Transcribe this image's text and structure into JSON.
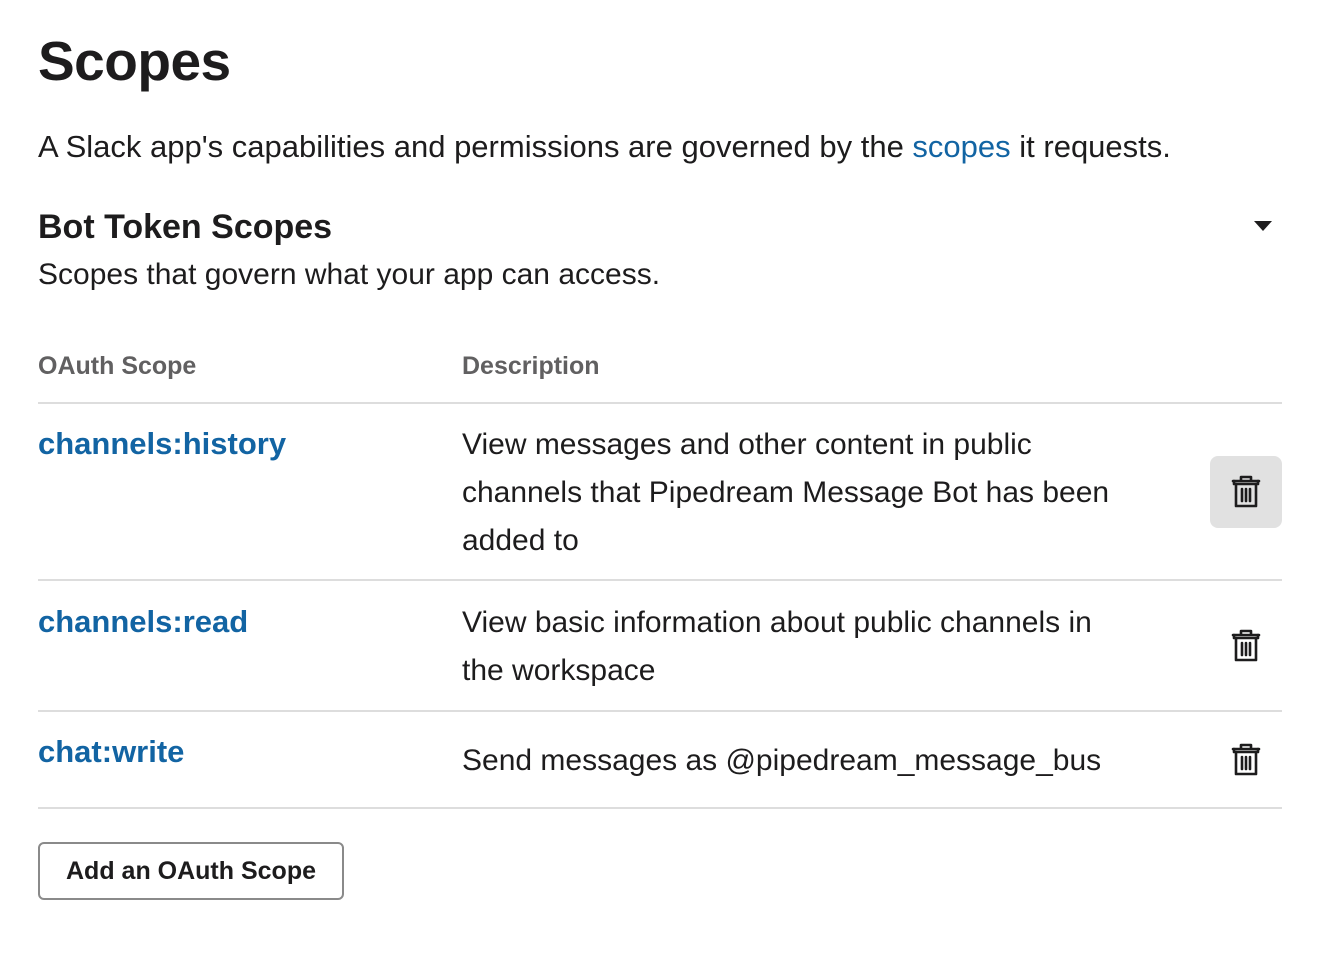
{
  "page": {
    "title": "Scopes",
    "intro_before": "A Slack app's capabilities and permissions are governed by the ",
    "intro_link": "scopes",
    "intro_after": " it requests."
  },
  "section": {
    "title": "Bot Token Scopes",
    "subtitle": "Scopes that govern what your app can access.",
    "toggle_icon": "caret-down-icon"
  },
  "table": {
    "headers": {
      "scope": "OAuth Scope",
      "description": "Description"
    },
    "rows": [
      {
        "scope": "channels:history",
        "description": "View messages and other content in public channels that Pipedream Message Bot has been added to",
        "action_icon": "trash-icon"
      },
      {
        "scope": "channels:read",
        "description": "View basic information about public channels in the workspace",
        "action_icon": "trash-icon"
      },
      {
        "scope": "chat:write",
        "description": "Send messages as @pipedream_message_bus",
        "action_icon": "trash-icon"
      }
    ]
  },
  "actions": {
    "add_scope_label": "Add an OAuth Scope"
  },
  "colors": {
    "link": "#1264a3",
    "text": "#1d1c1d",
    "muted": "#616061",
    "divider": "#dddddd",
    "hover_bg": "#e1e1e1"
  }
}
